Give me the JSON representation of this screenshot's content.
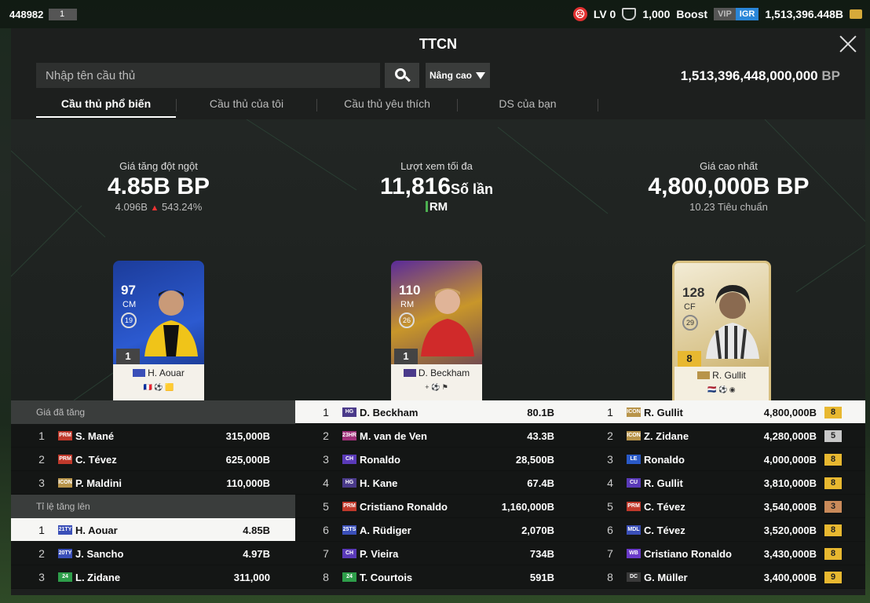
{
  "topbar": {
    "uid": "448982",
    "uid_badge": "1",
    "level": "LV 0",
    "shield_value": "1,000",
    "boost": "Boost",
    "vip": "VIP",
    "igr": "IGR",
    "balance": "1,513,396.448B",
    "icons": {
      "level": "sad-face-icon",
      "shield": "shield-icon",
      "coin": "bp-coin-icon"
    }
  },
  "panel": {
    "title": "TTCN",
    "search_placeholder": "Nhập tên cầu thủ",
    "advanced_label": "Nâng cao",
    "bp_total": "1,513,396,448,000,000",
    "bp_unit": "BP",
    "tabs": [
      "Cầu thủ phổ biến",
      "Cầu thủ của tôi",
      "Cầu thủ yêu thích",
      "DS của bạn"
    ]
  },
  "highlights": {
    "surge": {
      "label": "Giá tăng đột ngột",
      "value": "4.85B BP",
      "prev": "4.096B",
      "change": "543.24%"
    },
    "views": {
      "label": "Lượt xem tối đa",
      "value": "11,816",
      "unit": "Số lần",
      "position": "RM"
    },
    "top_price": {
      "label": "Giá cao nhất",
      "value": "4,800,000B BP",
      "sub": "10.23 Tiêu chuẩn"
    }
  },
  "cards": [
    {
      "ovr": "97",
      "pos": "CM",
      "season": "19",
      "grade": "1",
      "season_tag": "21TY",
      "name": "H. Aouar",
      "flags": "🇫🇷 ⚽ 🟨"
    },
    {
      "ovr": "110",
      "pos": "RM",
      "season": "26",
      "grade": "1",
      "season_tag": "HG",
      "name": "D. Beckham",
      "flags": "+ ⚽ ⚑"
    },
    {
      "ovr": "128",
      "pos": "CF",
      "season": "29",
      "grade": "8",
      "season_tag": "ICON",
      "name": "R. Gullit",
      "flags": "🇳🇱 ⚽ ◉"
    }
  ],
  "tables": {
    "left": {
      "sections": [
        {
          "title": "Giá đã tăng",
          "rows": [
            {
              "rank": "1",
              "badge": "PRM",
              "color": "#c0392b",
              "name": "S. Mané",
              "value": "315,000B"
            },
            {
              "rank": "2",
              "badge": "PRM",
              "color": "#c0392b",
              "name": "C. Tévez",
              "value": "625,000B"
            },
            {
              "rank": "3",
              "badge": "ICON",
              "color": "#b8944a",
              "name": "P. Maldini",
              "value": "110,000B"
            }
          ]
        },
        {
          "title": "Tỉ lệ tăng lên",
          "rows": [
            {
              "rank": "1",
              "badge": "21TY",
              "color": "#3a4fb8",
              "name": "H. Aouar",
              "value": "4.85B",
              "highlight": true
            },
            {
              "rank": "2",
              "badge": "20TY",
              "color": "#3a4fb8",
              "name": "J. Sancho",
              "value": "4.97B"
            },
            {
              "rank": "3",
              "badge": "24",
              "color": "#2e9e4a",
              "name": "L. Zidane",
              "value": "311,000"
            }
          ]
        }
      ]
    },
    "middle": {
      "rows": [
        {
          "rank": "1",
          "badge": "HG",
          "color": "#4a3a8a",
          "name": "D. Beckham",
          "value": "80.1B",
          "highlight": true
        },
        {
          "rank": "2",
          "badge": "23HR",
          "color": "#a0307a",
          "name": "M. van de Ven",
          "value": "43.3B"
        },
        {
          "rank": "3",
          "badge": "CH",
          "color": "#5a3ab8",
          "name": "Ronaldo",
          "value": "28,500B"
        },
        {
          "rank": "4",
          "badge": "HG",
          "color": "#4a3a8a",
          "name": "H. Kane",
          "value": "67.4B"
        },
        {
          "rank": "5",
          "badge": "PRM",
          "color": "#c0392b",
          "name": "Cristiano Ronaldo",
          "value": "1,160,000B"
        },
        {
          "rank": "6",
          "badge": "25TS",
          "color": "#3a4fb8",
          "name": "A. Rüdiger",
          "value": "2,070B"
        },
        {
          "rank": "7",
          "badge": "CH",
          "color": "#5a3ab8",
          "name": "P. Vieira",
          "value": "734B"
        },
        {
          "rank": "8",
          "badge": "24",
          "color": "#2e9e4a",
          "name": "T. Courtois",
          "value": "591B"
        }
      ]
    },
    "right": {
      "rows": [
        {
          "rank": "1",
          "badge": "ICON",
          "color": "#b8944a",
          "name": "R. Gullit",
          "value": "4,800,000B",
          "grade": "8",
          "gtype": "gold",
          "highlight": true
        },
        {
          "rank": "2",
          "badge": "ICON",
          "color": "#b8944a",
          "name": "Z. Zidane",
          "value": "4,280,000B",
          "grade": "5",
          "gtype": "silver"
        },
        {
          "rank": "3",
          "badge": "LE",
          "color": "#2a5ac8",
          "name": "Ronaldo",
          "value": "4,000,000B",
          "grade": "8",
          "gtype": "gold"
        },
        {
          "rank": "4",
          "badge": "CU",
          "color": "#5a3ab8",
          "name": "R. Gullit",
          "value": "3,810,000B",
          "grade": "8",
          "gtype": "gold"
        },
        {
          "rank": "5",
          "badge": "PRM",
          "color": "#c0392b",
          "name": "C. Tévez",
          "value": "3,540,000B",
          "grade": "3",
          "gtype": "bronze"
        },
        {
          "rank": "6",
          "badge": "MDL",
          "color": "#3a4fb8",
          "name": "C. Tévez",
          "value": "3,520,000B",
          "grade": "8",
          "gtype": "gold"
        },
        {
          "rank": "7",
          "badge": "WB",
          "color": "#6a3ac8",
          "name": "Cristiano Ronaldo",
          "value": "3,430,000B",
          "grade": "8",
          "gtype": "gold"
        },
        {
          "rank": "8",
          "badge": "DC",
          "color": "#3a3a3a",
          "name": "G. Müller",
          "value": "3,400,000B",
          "grade": "9",
          "gtype": "gold"
        }
      ]
    }
  }
}
